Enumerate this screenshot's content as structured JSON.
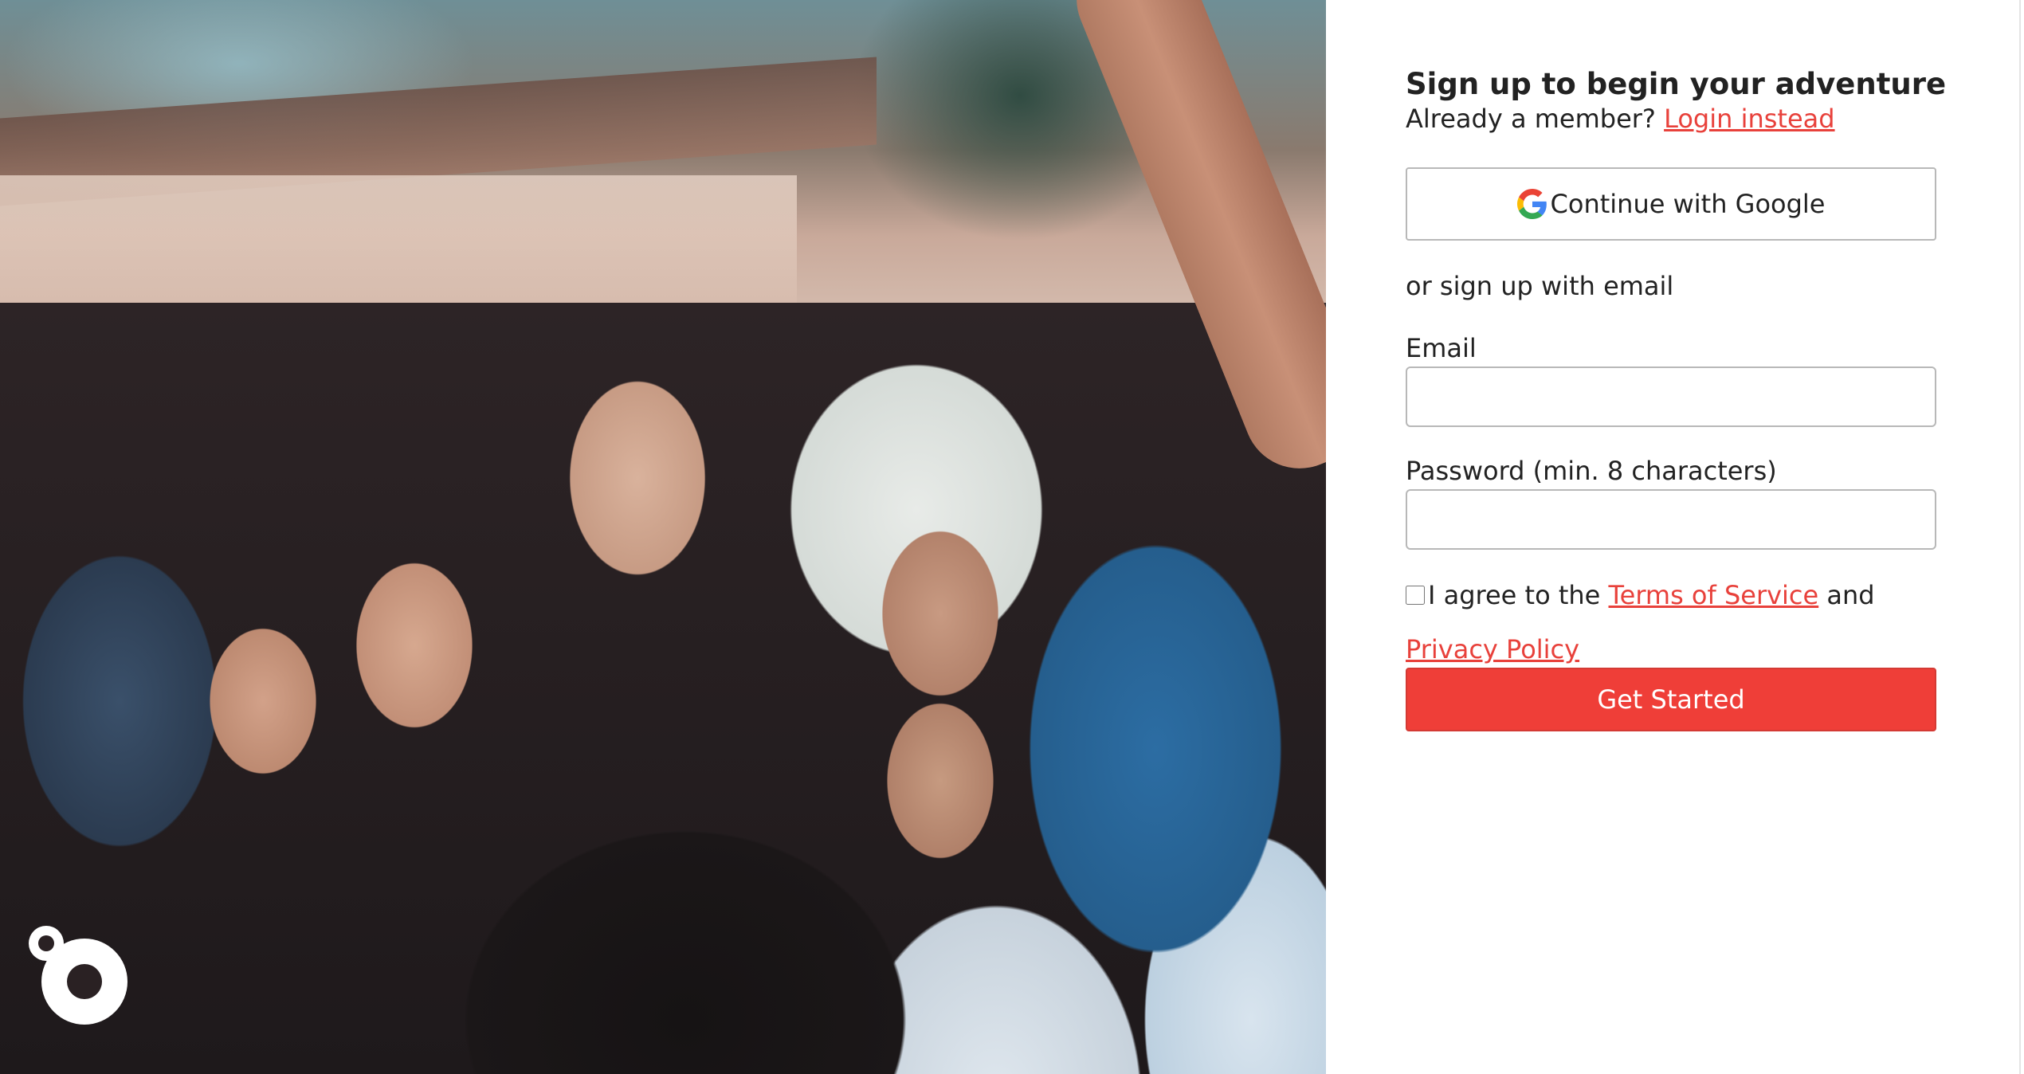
{
  "form": {
    "title": "Sign up to begin your adventure",
    "member_prompt": "Already a member?",
    "login_link": "Login instead",
    "google_button": "Continue with Google",
    "or_text": "or sign up with email",
    "email_label": "Email",
    "email_value": "",
    "password_label": "Password (min. 8 characters)",
    "password_value": "",
    "agree_prefix": "I agree to the",
    "terms_link": "Terms of Service",
    "agree_joiner": "and",
    "privacy_link": "Privacy Policy",
    "agree_checked": false,
    "submit_button": "Get Started"
  },
  "colors": {
    "accent": "#ef3e38",
    "link": "#e8413b",
    "input_border": "#b8b8b8"
  },
  "icons": {
    "google": "google-g-icon",
    "brand": "brand-logo-icon"
  }
}
